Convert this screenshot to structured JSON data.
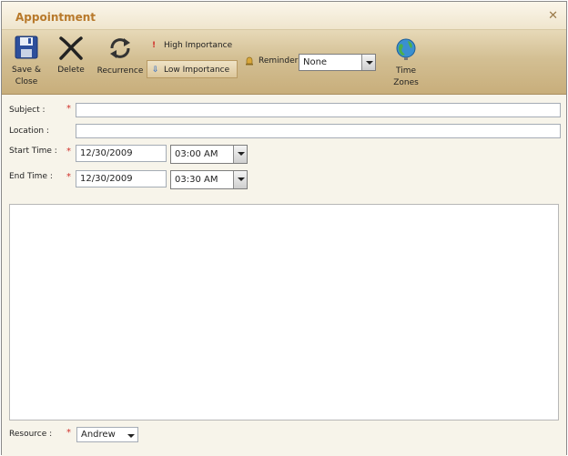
{
  "window": {
    "title": "Appointment"
  },
  "toolbar": {
    "save_close": {
      "line1": "Save &",
      "line2": "Close"
    },
    "delete": "Delete",
    "recurrence": "Recurrence",
    "high_importance": "High Importance",
    "low_importance": "Low Importance",
    "reminder_label": "Reminder",
    "reminder_value": "None",
    "time_zones": "Time Zones"
  },
  "form": {
    "subject_label": "Subject :",
    "subject_value": "",
    "location_label": "Location :",
    "location_value": "",
    "start_label": "Start Time :",
    "start_date": "12/30/2009",
    "start_time": "03:00 AM",
    "end_label": "End Time :",
    "end_date": "12/30/2009",
    "end_time": "03:30 AM",
    "description_value": "",
    "resource_label": "Resource :",
    "resource_value": "Andrew",
    "required_mark": "*"
  },
  "colors": {
    "title": "#b8792b",
    "required": "#d0302a",
    "toolbar": "#d3bf93"
  }
}
